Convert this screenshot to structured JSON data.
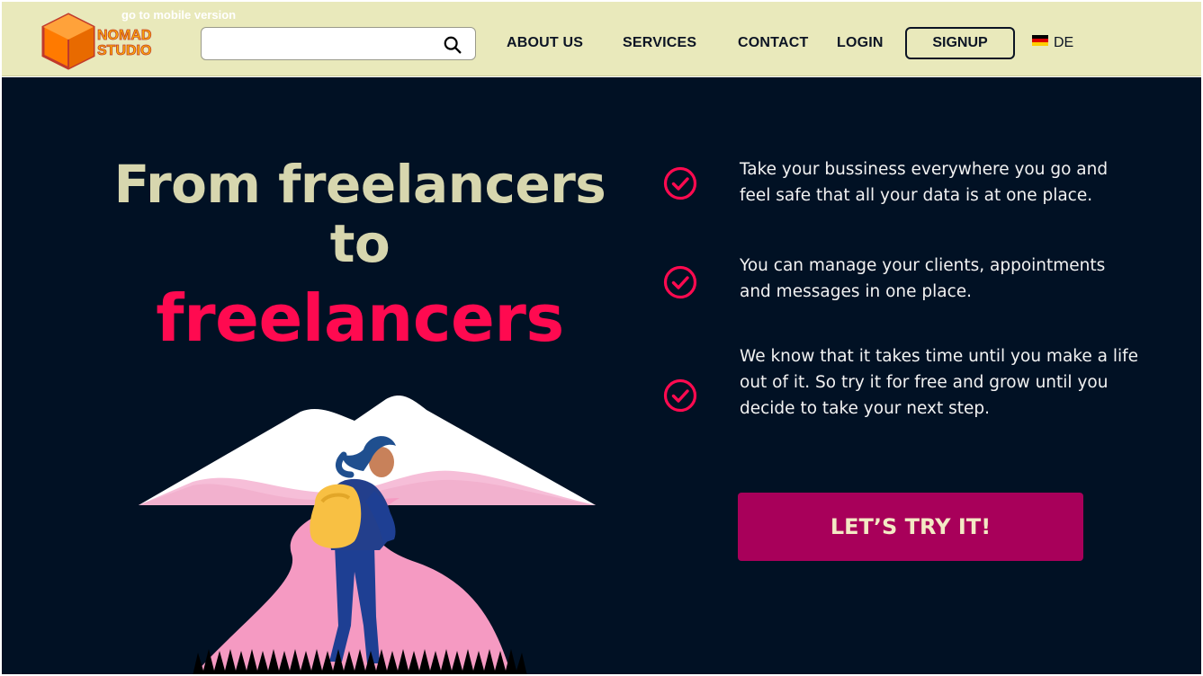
{
  "header": {
    "mobile_link": "go to mobile version",
    "logo_text_line1": "NOMAD",
    "logo_text_line2": "STUDIO",
    "search": {
      "value": "",
      "placeholder": "",
      "icon": "search-icon"
    },
    "nav": {
      "about": "ABOUT US",
      "services": "SERVICES",
      "contact": "CONTACT",
      "login": "LOGIN",
      "signup": "SIGNUP"
    },
    "language": {
      "flag": "germany-flag-icon",
      "label": "DE"
    }
  },
  "hero": {
    "headline_line1": "From freelancers",
    "headline_line2": "to",
    "headline_line3": "freelancers",
    "features": [
      {
        "icon": "check-circle-icon",
        "text_line1": "Take your bussiness everywhere you go and",
        "text_line2": "feel safe that all your data is at one place."
      },
      {
        "icon": "check-circle-icon",
        "text_line1": "You can manage your clients, appointments",
        "text_line2": "and messages in one place."
      },
      {
        "icon": "check-circle-icon",
        "text_line1": "We know that it takes time until you make a life",
        "text_line2": "out of it. So try it for free and grow until you",
        "text_line3": "decide to take your next step."
      }
    ],
    "cta_label": "LET’S TRY IT!"
  },
  "colors": {
    "header_bg": "#e9e9bb",
    "hero_bg": "#011124",
    "headline": "#d7d6ae",
    "accent": "#ff0a50",
    "cta_bg": "#a8005a",
    "cta_text": "#f3e9c4"
  }
}
